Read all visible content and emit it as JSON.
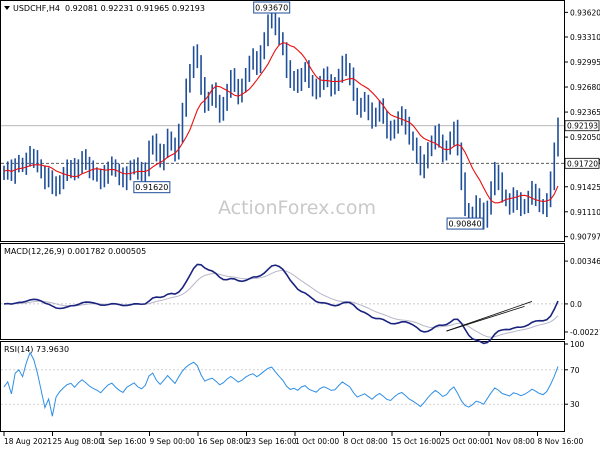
{
  "header": {
    "symbol": "USDCHF,H4",
    "ohlc": "0.92081 0.92231 0.91965 0.92193"
  },
  "watermark": "ActionForex.com",
  "colors": {
    "candles": "#1f4e9a",
    "ma": "#e81010",
    "macd": "#1a237e",
    "signal": "#b7b7c9",
    "rsi": "#2f8fe6",
    "trendline": "#111111",
    "label_border": "#1f4e9a"
  },
  "chart_data": [
    {
      "type": "candlestick",
      "title": "USDCHF,H4",
      "ylim": [
        0.9078,
        0.937
      ],
      "y_ticks": [
        "0.93620",
        "0.93310",
        "0.92995",
        "0.92680",
        "0.92365",
        "0.92050",
        "0.91740",
        "0.91425",
        "0.91110",
        "0.90797"
      ],
      "y_tick_values": [
        0.9362,
        0.9331,
        0.92995,
        0.9268,
        0.92365,
        0.9205,
        0.9174,
        0.91425,
        0.9111,
        0.90797
      ],
      "x_ticks": [
        "18 Aug 2021",
        "25 Aug 08:00",
        "1 Sep 16:00",
        "9 Sep 00:00",
        "16 Sep 08:00",
        "23 Sep 16:00",
        "1 Oct 00:00",
        "8 Oct 08:00",
        "15 Oct 16:00",
        "25 Oct 00:00",
        "1 Nov 08:00",
        "8 Nov 16:00"
      ],
      "current_price": "0.92193",
      "ref_level": "0.91720",
      "annotations": [
        {
          "text": "0.93670",
          "index": 72
        },
        {
          "text": "0.91620",
          "index": 36
        },
        {
          "text": "0.90840",
          "index": 124
        }
      ],
      "close": [
        0.9162,
        0.9165,
        0.9158,
        0.917,
        0.9172,
        0.9168,
        0.9176,
        0.9182,
        0.9178,
        0.917,
        0.916,
        0.915,
        0.9155,
        0.9145,
        0.914,
        0.915,
        0.9158,
        0.9165,
        0.9168,
        0.916,
        0.917,
        0.9178,
        0.9172,
        0.9165,
        0.916,
        0.9156,
        0.915,
        0.9158,
        0.9166,
        0.917,
        0.9162,
        0.9155,
        0.915,
        0.916,
        0.9165,
        0.917,
        0.9162,
        0.9158,
        0.9165,
        0.919,
        0.92,
        0.9185,
        0.9175,
        0.9188,
        0.9205,
        0.9195,
        0.9185,
        0.921,
        0.924,
        0.9268,
        0.929,
        0.931,
        0.93,
        0.927,
        0.9245,
        0.9255,
        0.9262,
        0.925,
        0.9235,
        0.9245,
        0.9265,
        0.928,
        0.927,
        0.9258,
        0.9268,
        0.9285,
        0.9298,
        0.9305,
        0.9295,
        0.931,
        0.933,
        0.935,
        0.936,
        0.9345,
        0.933,
        0.9315,
        0.929,
        0.9275,
        0.928,
        0.927,
        0.9285,
        0.929,
        0.9275,
        0.9268,
        0.9262,
        0.9275,
        0.9282,
        0.9276,
        0.9268,
        0.927,
        0.9284,
        0.9298,
        0.929,
        0.9282,
        0.926,
        0.924,
        0.9245,
        0.925,
        0.9238,
        0.9225,
        0.9235,
        0.9242,
        0.923,
        0.9215,
        0.921,
        0.922,
        0.9228,
        0.9232,
        0.922,
        0.9205,
        0.9195,
        0.9182,
        0.9165,
        0.9175,
        0.9188,
        0.92,
        0.921,
        0.92,
        0.9185,
        0.919,
        0.9205,
        0.9215,
        0.919,
        0.915,
        0.9115,
        0.91,
        0.9108,
        0.912,
        0.9112,
        0.9098,
        0.9118,
        0.914,
        0.9162,
        0.915,
        0.9132,
        0.9125,
        0.9118,
        0.913,
        0.9125,
        0.9115,
        0.912,
        0.9128,
        0.9138,
        0.913,
        0.912,
        0.9115,
        0.9125,
        0.915,
        0.919,
        0.9219
      ]
    },
    {
      "type": "line",
      "title": "MACD(12,26,9) 0.001782 0.000505",
      "ylim": [
        -0.0026,
        0.0038
      ],
      "y_ticks": [
        "0.003468",
        "0.0",
        "-0.002274"
      ],
      "y_tick_values": [
        0.003468,
        0.0,
        -0.002274
      ]
    },
    {
      "type": "line",
      "title": "RSI(14) 73.9630",
      "ylim": [
        0,
        100
      ],
      "y_ticks": [
        "100",
        "70",
        "30",
        "0"
      ],
      "y_tick_values": [
        100,
        70,
        30,
        0
      ],
      "levels": [
        70,
        30
      ]
    }
  ]
}
